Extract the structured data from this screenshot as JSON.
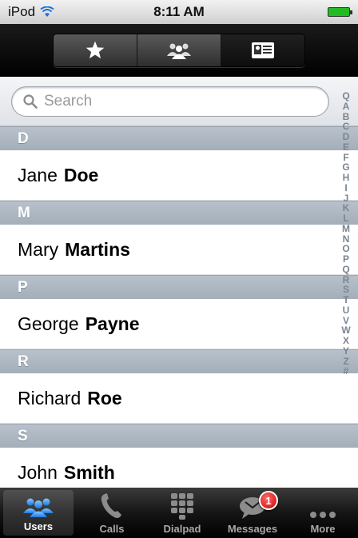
{
  "status_bar": {
    "carrier": "iPod",
    "time": "8:11 AM"
  },
  "toolbar": {
    "segments": [
      {
        "icon": "star-icon",
        "active": false
      },
      {
        "icon": "group-icon",
        "active": false
      },
      {
        "icon": "contact-card-icon",
        "active": true
      }
    ]
  },
  "search": {
    "placeholder": "Search"
  },
  "sections": [
    {
      "letter": "D",
      "contacts": [
        {
          "first": "Jane",
          "last": "Doe"
        }
      ]
    },
    {
      "letter": "M",
      "contacts": [
        {
          "first": "Mary",
          "last": "Martins"
        }
      ]
    },
    {
      "letter": "P",
      "contacts": [
        {
          "first": "George",
          "last": "Payne"
        }
      ]
    },
    {
      "letter": "R",
      "contacts": [
        {
          "first": "Richard",
          "last": "Roe"
        }
      ]
    },
    {
      "letter": "S",
      "contacts": [
        {
          "first": "John",
          "last": "Smith"
        }
      ]
    }
  ],
  "index_letters": [
    "Q",
    "A",
    "B",
    "C",
    "D",
    "E",
    "F",
    "G",
    "H",
    "I",
    "J",
    "K",
    "L",
    "M",
    "N",
    "O",
    "P",
    "Q",
    "R",
    "S",
    "T",
    "U",
    "V",
    "W",
    "X",
    "Y",
    "Z",
    "#"
  ],
  "tabbar": {
    "tabs": [
      {
        "label": "Users",
        "icon": "users-icon",
        "active": true
      },
      {
        "label": "Calls",
        "icon": "phone-icon",
        "active": false
      },
      {
        "label": "Dialpad",
        "icon": "dialpad-icon",
        "active": false
      },
      {
        "label": "Messages",
        "icon": "message-icon",
        "active": false,
        "badge": "1"
      },
      {
        "label": "More",
        "icon": "more-icon",
        "active": false
      }
    ]
  }
}
